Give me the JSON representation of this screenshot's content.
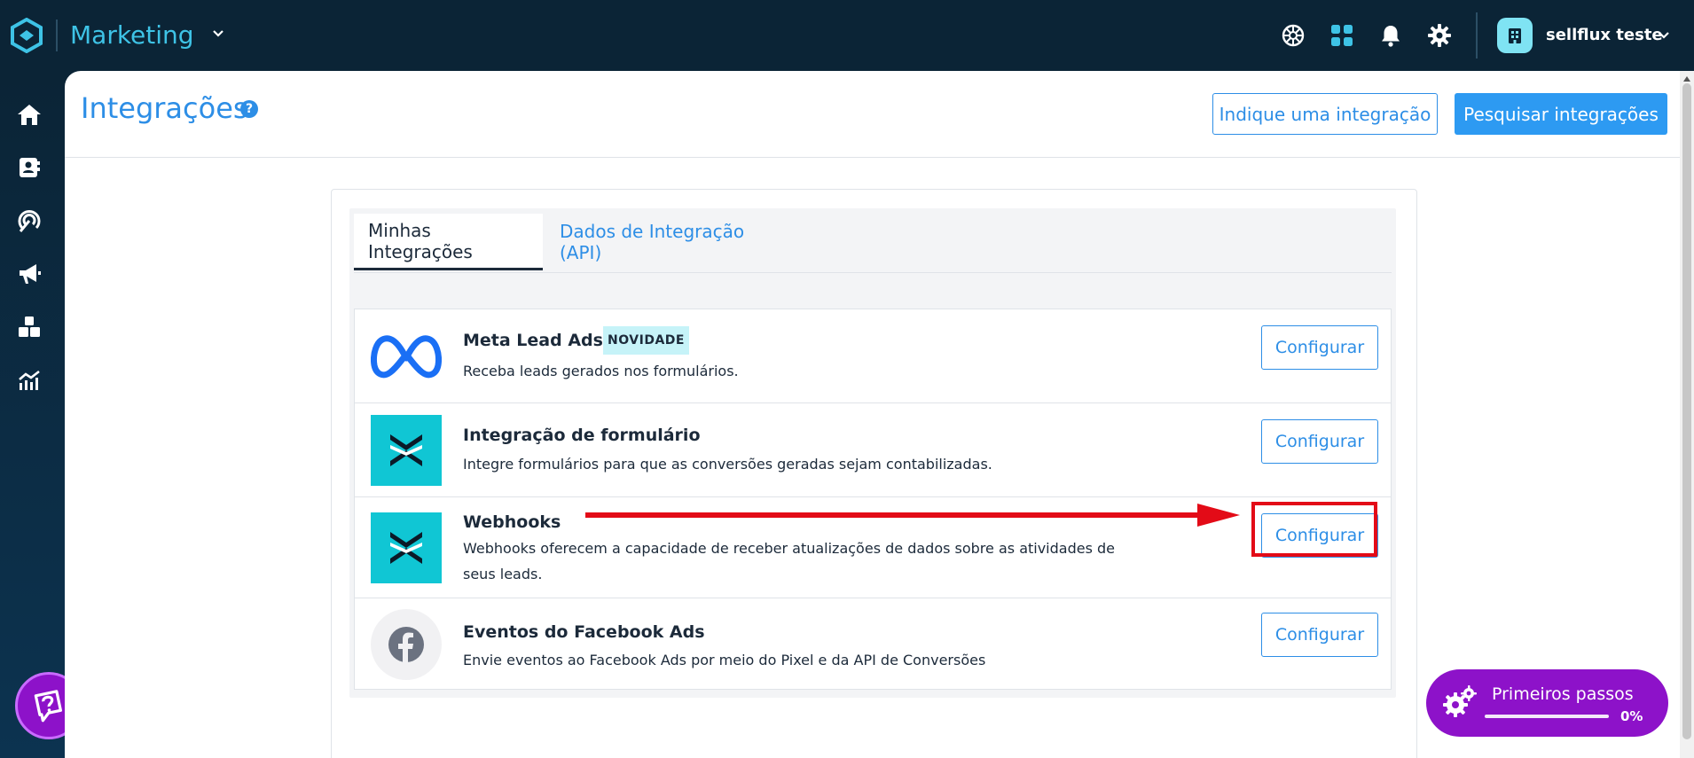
{
  "app": {
    "name": "Marketing"
  },
  "header": {
    "user_name": "sellflux teste"
  },
  "page": {
    "title": "Integrações",
    "help_symbol": "?",
    "suggest_button": "Indique uma integração",
    "search_button": "Pesquisar integrações"
  },
  "tabs": [
    {
      "label": "Minhas Integrações",
      "active": true
    },
    {
      "label": "Dados de Integração (API)",
      "active": false
    }
  ],
  "integrations": [
    {
      "title": "Meta Lead Ads",
      "badge": "NOVIDADE",
      "description": "Receba leads gerados nos formulários.",
      "button": "Configurar",
      "icon": "meta-icon"
    },
    {
      "title": "Integração de formulário",
      "description": "Integre formulários para que as conversões geradas sejam contabilizadas.",
      "button": "Configurar",
      "icon": "sellflux-icon"
    },
    {
      "title": "Webhooks",
      "description_line1": "Webhooks oferecem a capacidade de receber atualizações de dados sobre as atividades de",
      "description_line2": "seus leads.",
      "button": "Configurar",
      "icon": "sellflux-icon"
    },
    {
      "title": "Eventos do Facebook Ads",
      "description": "Envie eventos ao Facebook Ads por meio do Pixel e da API de Conversões",
      "button": "Configurar",
      "icon": "facebook-icon"
    }
  ],
  "onboarding": {
    "label": "Primeiros passos",
    "progress_text": "0%",
    "progress": 0
  },
  "colors": {
    "topbar": "#0b2436",
    "accent": "#2d8ee6",
    "teal": "#10c6d4",
    "purple": "#8d12c9",
    "highlight": "#e30b17"
  }
}
